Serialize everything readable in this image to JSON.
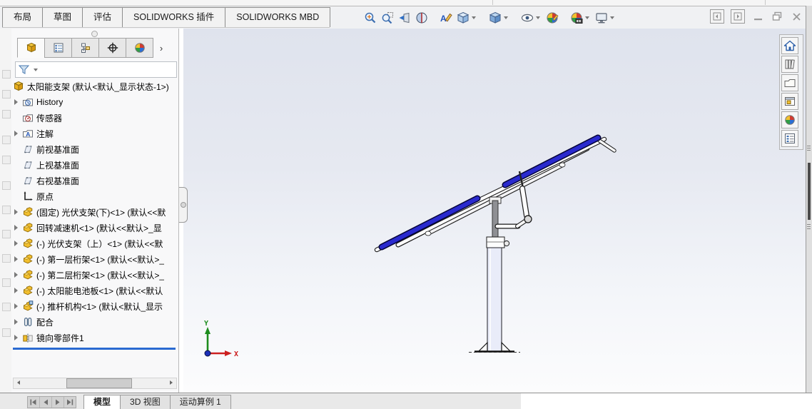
{
  "ribbon": {
    "tabs": [
      {
        "name": "layout",
        "label": "布局"
      },
      {
        "name": "sketch",
        "label": "草图"
      },
      {
        "name": "evaluate",
        "label": "评估"
      },
      {
        "name": "solidworks-addins",
        "label": "SOLIDWORKS 插件"
      },
      {
        "name": "solidworks-mbd",
        "label": "SOLIDWORKS MBD"
      }
    ]
  },
  "headsup": {
    "tools": [
      {
        "name": "zoom-to-fit",
        "icon": "zoom-fit-icon",
        "caret": false
      },
      {
        "name": "zoom-to-area",
        "icon": "zoom-area-icon",
        "caret": false
      },
      {
        "name": "previous-view",
        "icon": "previous-view-icon",
        "caret": false
      },
      {
        "name": "section-view",
        "icon": "section-view-icon",
        "caret": false
      },
      {
        "name": "hide-show-annotations",
        "icon": "annotation-icon",
        "caret": false,
        "gap": true
      },
      {
        "name": "view-orientation",
        "icon": "view-cube-icon",
        "caret": true
      },
      {
        "name": "display-style",
        "icon": "shaded-cube-icon",
        "caret": true,
        "gap": true
      },
      {
        "name": "hide-show-items",
        "icon": "eye-icon",
        "caret": true,
        "gap": true
      },
      {
        "name": "edit-appearance",
        "icon": "appearance-ball-icon",
        "caret": false
      },
      {
        "name": "apply-scene",
        "icon": "scene-ball-icon",
        "caret": true,
        "gap": true
      },
      {
        "name": "view-settings",
        "icon": "monitor-icon",
        "caret": true
      }
    ]
  },
  "left_panel": {
    "manager_tabs": [
      {
        "name": "featuremanager-tree",
        "icon": "assembly-icon",
        "active": true
      },
      {
        "name": "propertymanager",
        "icon": "propertymanager-icon",
        "active": false
      },
      {
        "name": "configurationmanager",
        "icon": "configmanager-icon",
        "active": false
      },
      {
        "name": "dimxpertmanager",
        "icon": "dimxpert-icon",
        "active": false
      },
      {
        "name": "displaymanager",
        "icon": "colorball-icon",
        "active": false
      }
    ],
    "chevron": "›",
    "tree": [
      {
        "icon": "assembly-icon",
        "label": "太阳能支架 (默认<默认_显示状态-1>)",
        "expand": false,
        "root": true
      },
      {
        "icon": "history-folder-icon",
        "label": "History",
        "expand": true
      },
      {
        "icon": "sensors-folder-icon",
        "label": "传感器",
        "expand": false
      },
      {
        "icon": "annotations-folder-icon",
        "label": "注解",
        "expand": true
      },
      {
        "icon": "plane-icon",
        "label": "前视基准面",
        "expand": false
      },
      {
        "icon": "plane-icon",
        "label": "上视基准面",
        "expand": false
      },
      {
        "icon": "plane-icon",
        "label": "右视基准面",
        "expand": false
      },
      {
        "icon": "origin-icon",
        "label": "原点",
        "expand": false
      },
      {
        "icon": "part-icon",
        "label": "(固定) 光伏支架(下)<1> (默认<<默",
        "expand": true
      },
      {
        "icon": "part-icon",
        "label": "回转减速机<1> (默认<<默认>_显",
        "expand": true
      },
      {
        "icon": "part-icon",
        "label": "(-) 光伏支架（上）<1> (默认<<默",
        "expand": true
      },
      {
        "icon": "part-icon",
        "label": "(-) 第一层桁架<1> (默认<<默认>_",
        "expand": true
      },
      {
        "icon": "part-icon",
        "label": "(-) 第二层桁架<1> (默认<<默认>_",
        "expand": true
      },
      {
        "icon": "part-icon",
        "label": "(-) 太阳能电池板<1> (默认<<默认",
        "expand": true
      },
      {
        "icon": "subassembly-icon",
        "label": "(-) 推杆机构<1> (默认<默认_显示",
        "expand": true
      },
      {
        "icon": "mates-icon",
        "label": "配合",
        "expand": true
      },
      {
        "icon": "mirror-icon",
        "label": "镜向零部件1",
        "expand": true,
        "rollback_after": true
      }
    ]
  },
  "viewport": {
    "triad": {
      "x_label": "X",
      "y_label": "Y"
    }
  },
  "right_pane": {
    "buttons": [
      {
        "name": "home",
        "icon": "home-icon"
      },
      {
        "name": "solidworks-resources",
        "icon": "books-icon"
      },
      {
        "name": "design-library",
        "icon": "folder-icon"
      },
      {
        "name": "file-explorer",
        "icon": "explorer-icon"
      },
      {
        "name": "appearances-scenes",
        "icon": "colorball-icon"
      },
      {
        "name": "custom-properties",
        "icon": "properties-form-icon"
      }
    ]
  },
  "bottom": {
    "doc_tabs": [
      {
        "name": "model",
        "label": "模型",
        "active": true
      },
      {
        "name": "3d-views",
        "label": "3D 视图",
        "active": false
      },
      {
        "name": "motion-study-1",
        "label": "运动算例 1",
        "active": false
      }
    ]
  },
  "colors": {
    "panel_blue": "#2a2ace",
    "panel_outline": "#04043a",
    "rollback_blue": "#2a6ad1",
    "axis_x_red": "#cc2020",
    "axis_y_green": "#1d8c1d",
    "axis_z_blue": "#1c2fb8",
    "tube_fill": "#e9ecf9",
    "post_gray": "#8f9094"
  }
}
